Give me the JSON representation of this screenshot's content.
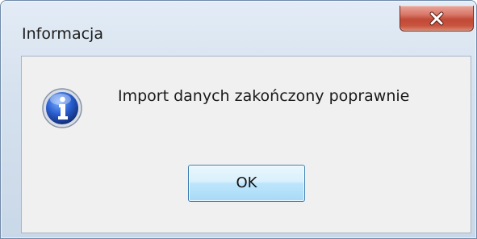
{
  "window": {
    "title": "Informacja"
  },
  "dialog": {
    "message": "Import danych zakończony poprawnie",
    "icon": "information-icon",
    "ok_label": "OK"
  },
  "titlebar": {
    "close_icon": "close-icon"
  },
  "colors": {
    "close_button": "#c7503c",
    "ok_border": "#3c7fb1",
    "client_background": "#f0f0f0",
    "info_icon_blue": "#1f4fa8"
  }
}
